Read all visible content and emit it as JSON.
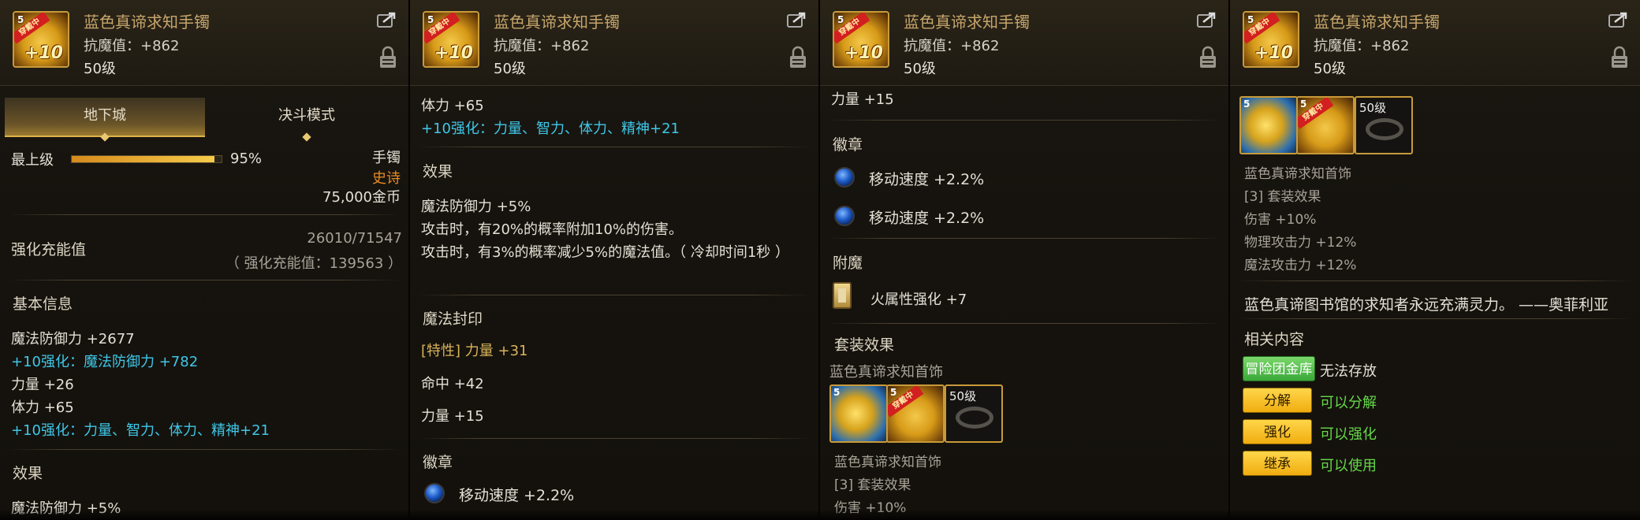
{
  "item": {
    "name": "蓝色真谛求知手镯",
    "resist": "抗魔值：+862",
    "level": "50级",
    "icon_level": "5",
    "icon_ribbon": "穿戴中",
    "icon_plus": "+10"
  },
  "panel1": {
    "tabs": [
      "地下城",
      "决斗模式"
    ],
    "grade_label": "最上级",
    "grade_percent_text": "95%",
    "grade_percent": 95,
    "slot_type": "手镯",
    "rarity": "史诗",
    "price": "75,000金币",
    "charge_label": "强化充能值",
    "charge_value": "26010/71547",
    "charge_sub": "（ 强化充能值：139563 ）",
    "basic_title": "基本信息",
    "basic_lines": [
      "魔法防御力 +2677",
      "+10强化：魔法防御力 +782",
      "力量 +26",
      "体力 +65",
      "+10强化：力量、智力、体力、精神+21"
    ],
    "effect_title": "效果",
    "effect_first": "魔法防御力 +5%"
  },
  "panel2": {
    "top_lines": [
      "体力 +65",
      "+10强化：力量、智力、体力、精神+21"
    ],
    "effect_title": "效果",
    "effect_lines": [
      "魔法防御力 +5%",
      "攻击时，有20%的概率附加10%的伤害。",
      "攻击时，有3%的概率减少5%的魔法值。（ 冷却时间1秒 ）"
    ],
    "seal_title": "魔法封印",
    "seal_lines": [
      "[特性] 力量 +31",
      "命中 +42",
      "力量 +15"
    ],
    "emblem_title": "徽章",
    "emblem_line": "移动速度 +2.2%"
  },
  "panel3": {
    "top_line": "力量 +15",
    "emblem_title": "徽章",
    "emblem_lines": [
      "移动速度 +2.2%",
      "移动速度 +2.2%"
    ],
    "enchant_title": "附魔",
    "enchant_line": "火属性强化 +7",
    "set_title": "套装效果",
    "set_name": "蓝色真谛求知首饰",
    "slot_level_label": "50级",
    "set_sub_name": "蓝色真谛求知首饰",
    "set_count": "[3] 套装效果",
    "set_first": "伤害 +10%"
  },
  "panel4": {
    "slot_level_label": "50级",
    "set_sub_name": "蓝色真谛求知首饰",
    "set_count": "[3] 套装效果",
    "set_lines": [
      "伤害 +10%",
      "物理攻击力 +12%",
      "魔法攻击力 +12%"
    ],
    "flavor": "蓝色真谛图书馆的求知者永远充满灵力。 ——奥菲利亚",
    "related_title": "相关内容",
    "actions": [
      {
        "button": "冒险团金库",
        "desc": "无法存放",
        "style": "green"
      },
      {
        "button": "分解",
        "desc": "可以分解",
        "style": "gold"
      },
      {
        "button": "强化",
        "desc": "可以强化",
        "style": "gold"
      },
      {
        "button": "继承",
        "desc": "可以使用",
        "style": "gold"
      }
    ]
  },
  "icons": [
    "bangle-item-icon",
    "share-icon",
    "lock-icon",
    "blue-emblem-icon",
    "enchant-card-icon",
    "necklace-icon",
    "ring-icon"
  ]
}
